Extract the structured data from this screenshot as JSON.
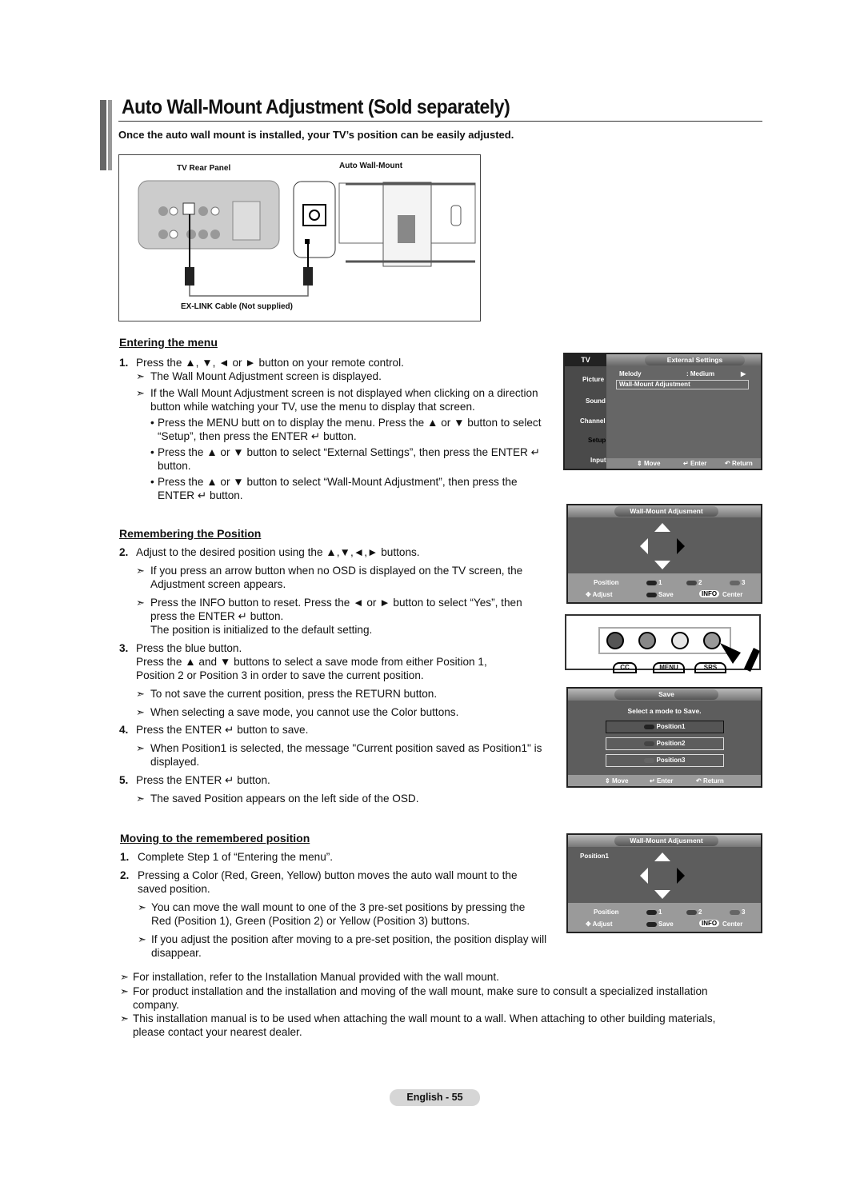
{
  "title": "Auto Wall-Mount Adjustment (Sold separately)",
  "subtitle": "Once the auto wall mount is installed, your TV’s position can be easily adjusted.",
  "diagram": {
    "left_label": "TV Rear Panel",
    "right_label": "Auto Wall-Mount",
    "cable_label": "EX-LINK Cable (Not supplied)",
    "port_label": "EX-LINK"
  },
  "sections": {
    "entering": {
      "heading": "Entering the menu",
      "s1": "Press the ▲, ▼, ◄ or ► button on your remote control.",
      "n1": "The Wall Mount Adjustment screen is displayed.",
      "n2": "If the Wall Mount Adjustment screen is not displayed when clicking on a direction button while watching your TV, use the menu to display that screen.",
      "b1": "Press the MENU butt on to display the menu. Press the ▲ or ▼ button to select “Setup”, then press the ENTER ↵ button.",
      "b2": "Press the ▲ or ▼ button to select “External Settings”, then press the ENTER ↵ button.",
      "b3": "Press the ▲ or ▼ button to select “Wall-Mount Adjustment”, then press the ENTER ↵ button."
    },
    "remember": {
      "heading": "Remembering the Position",
      "s2": "Adjust to the desired position using the ▲,▼,◄,► buttons.",
      "n1": "If you press an arrow button when no OSD is displayed on the TV screen, the Adjustment screen appears.",
      "n2": "Press the INFO button to reset. Press the ◄ or ► button to select “Yes”, then press the ENTER ↵ button.",
      "n2b": "The position is initialized to the default setting.",
      "s3": "Press the blue button.",
      "s3b": "Press the ▲ and ▼ buttons to select a save mode from either Position 1, Position 2 or Position 3 in order to save the current position.",
      "n3": "To not save the current position, press the RETURN button.",
      "n4": "When selecting a save mode, you cannot use the Color buttons.",
      "s4": "Press the ENTER ↵ button to save.",
      "n5": "When Position1 is selected, the message \"Current position saved as Position1\" is displayed.",
      "s5": "Press the ENTER ↵ button.",
      "n6": "The saved Position appears on the left side of the OSD."
    },
    "moving": {
      "heading": "Moving to the remembered position",
      "s1": "Complete Step 1 of “Entering the menu”.",
      "s2": "Pressing a Color (Red, Green, Yellow) button moves the auto wall mount to the saved position.",
      "n1": "You can move the wall mount to one of the 3 pre-set positions by pressing the Red (Position 1), Green (Position 2) or Yellow (Position 3) buttons.",
      "n2": "If you adjust the position after moving to a pre-set position, the position display will disappear."
    }
  },
  "numbers": [
    "1.",
    "2.",
    "3.",
    "4.",
    "5."
  ],
  "notes": [
    "For installation, refer to the Installation Manual provided with the wall mount.",
    "For product installation and the installation and moving of the wall mount, make sure to consult a specialized installation company.",
    "This installation manual is to be used when attaching the wall mount to a wall. When attaching to other building materials, please contact your nearest dealer."
  ],
  "osd_menu": {
    "tab": "TV",
    "header": "External Settings",
    "side": [
      "Picture",
      "Sound",
      "Channel",
      "Setup",
      "Input"
    ],
    "row1_label": "Melody",
    "row1_value": ": Medium",
    "row2_label": "Wall-Mount Adjustment",
    "move": "Move",
    "enter": "Enter",
    "return": "Return"
  },
  "osd_adjust": {
    "header": "Wall-Mount Adjusment",
    "position": "Position",
    "p1": "1",
    "p2": "2",
    "p3": "3",
    "adjust": "Adjust",
    "save": "Save",
    "info": "INFO",
    "center": "Center",
    "saved_position": "Position1"
  },
  "remote": {
    "cc": "CC",
    "menu": "MENU",
    "srs": "SRS"
  },
  "osd_save": {
    "header": "Save",
    "prompt": "Select a mode to Save.",
    "options": [
      "Position1",
      "Position2",
      "Position3"
    ],
    "move": "Move",
    "enter": "Enter",
    "return": "Return"
  },
  "footer": "English - 55"
}
